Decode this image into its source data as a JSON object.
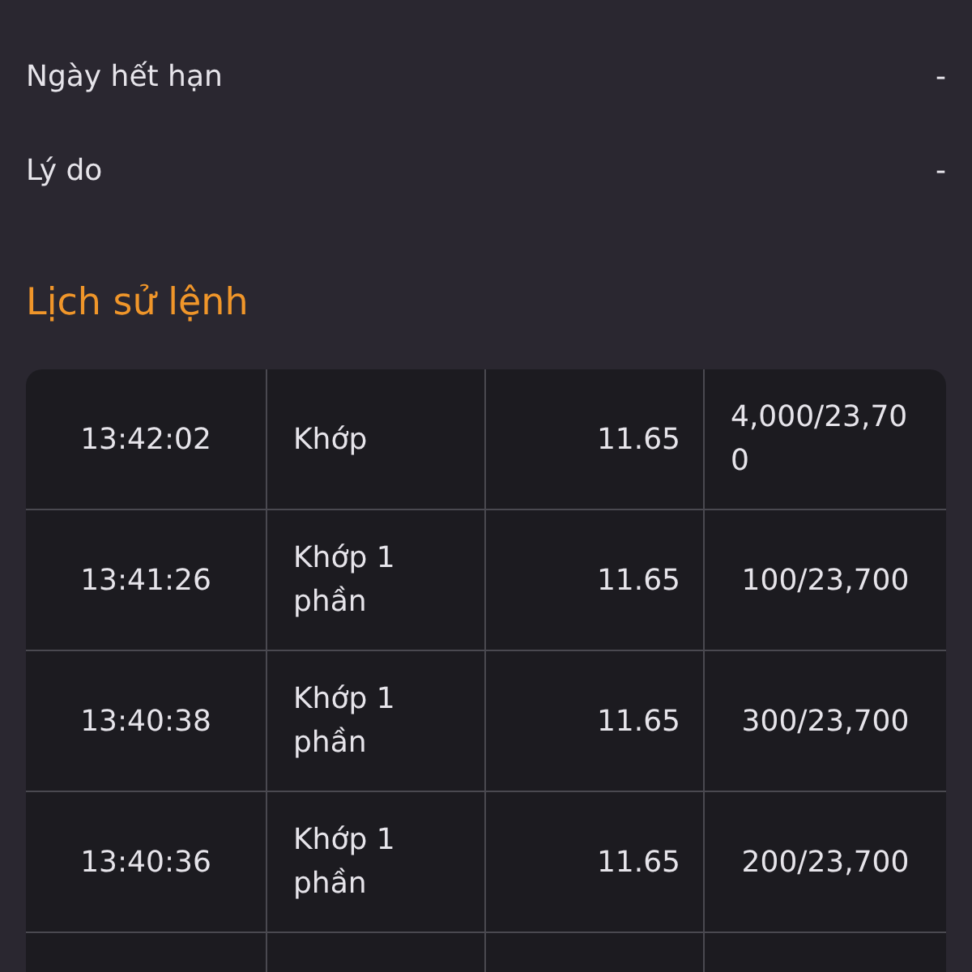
{
  "details": [
    {
      "label": "Ngày hết hạn",
      "value": "-"
    },
    {
      "label": "Lý do",
      "value": "-"
    }
  ],
  "history": {
    "title": "Lịch sử lệnh",
    "rows": [
      {
        "time": "13:42:02",
        "status": "Khớp",
        "price": "11.65",
        "quantity": "4,000/23,700"
      },
      {
        "time": "13:41:26",
        "status": "Khớp 1 phần",
        "price": "11.65",
        "quantity": "100/23,700"
      },
      {
        "time": "13:40:38",
        "status": "Khớp 1 phần",
        "price": "11.65",
        "quantity": "300/23,700"
      },
      {
        "time": "13:40:36",
        "status": "Khớp 1 phần",
        "price": "11.65",
        "quantity": "200/23,700"
      }
    ]
  }
}
